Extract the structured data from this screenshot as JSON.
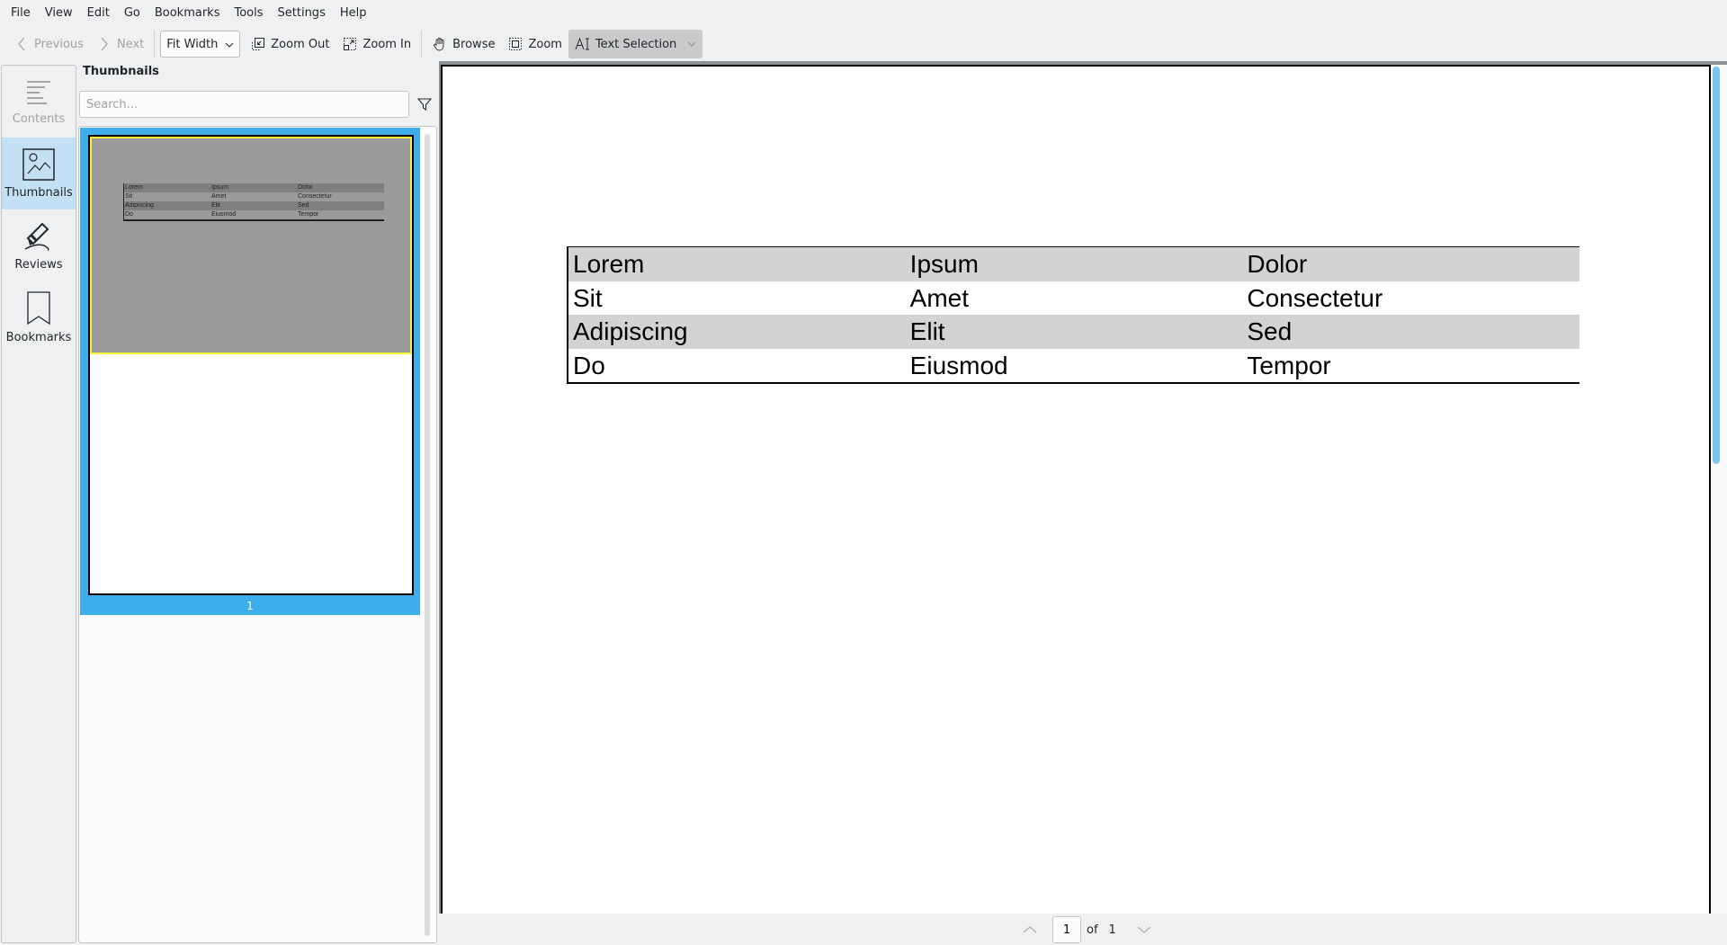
{
  "menu": [
    "File",
    "View",
    "Edit",
    "Go",
    "Bookmarks",
    "Tools",
    "Settings",
    "Help"
  ],
  "toolbar": {
    "previous": "Previous",
    "next": "Next",
    "zoom_mode": "Fit Width",
    "zoom_out": "Zoom Out",
    "zoom_in": "Zoom In",
    "browse": "Browse",
    "zoom": "Zoom",
    "text_selection": "Text Selection"
  },
  "sidebar": {
    "items": [
      {
        "label": "Contents",
        "icon": "contents-icon",
        "state": "disabled"
      },
      {
        "label": "Thumbnails",
        "icon": "thumbnails-icon",
        "state": "active"
      },
      {
        "label": "Reviews",
        "icon": "reviews-icon",
        "state": "normal"
      },
      {
        "label": "Bookmarks",
        "icon": "bookmarks-icon",
        "state": "normal"
      }
    ]
  },
  "thumbnails": {
    "title": "Thumbnails",
    "search_placeholder": "Search...",
    "search_value": "",
    "pages": [
      {
        "number": "1",
        "selected": true
      }
    ]
  },
  "document": {
    "table": [
      [
        "Lorem",
        "Ipsum",
        "Dolor"
      ],
      [
        "Sit",
        "Amet",
        "Consectetur"
      ],
      [
        "Adipiscing",
        "Elit",
        "Sed"
      ],
      [
        "Do",
        "Eiusmod",
        "Tempor"
      ]
    ]
  },
  "navigation": {
    "current_page": "1",
    "of_label": "of",
    "total_pages": "1"
  },
  "colors": {
    "accent": "#3daee9",
    "sidebar_active": "#c3e0f5",
    "row_shade": "#d3d3d3",
    "thumbnail_viewport_border": "#f5f038"
  }
}
